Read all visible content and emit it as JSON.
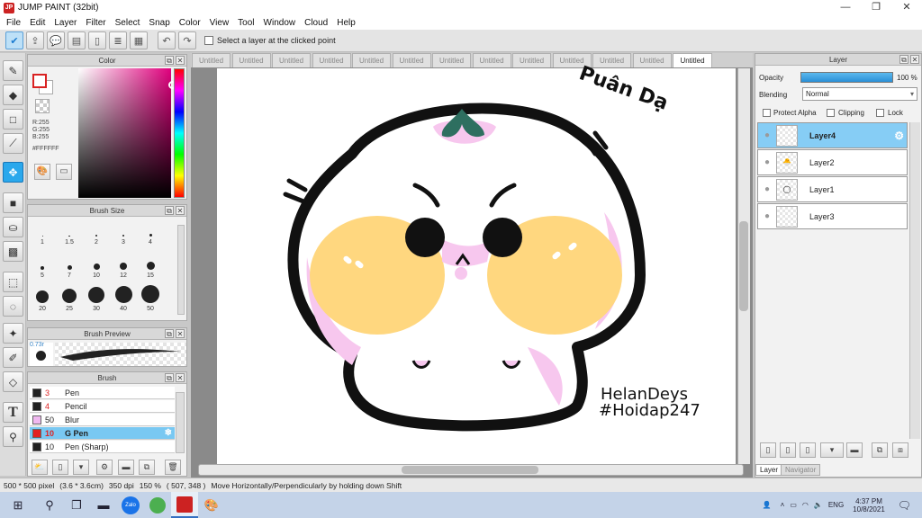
{
  "window": {
    "title": "JUMP PAINT (32bit)",
    "app_icon_text": "JP",
    "controls": [
      "—",
      "❐",
      "✕"
    ]
  },
  "menu": [
    "File",
    "Edit",
    "Layer",
    "Filter",
    "Select",
    "Snap",
    "Color",
    "View",
    "Tool",
    "Window",
    "Cloud",
    "Help"
  ],
  "toolbar": {
    "checkbox_label": "Select a layer at the clicked point"
  },
  "color_panel": {
    "title": "Color",
    "r": "R:255",
    "g": "G:255",
    "b": "B:255",
    "hex": "#FFFFFF",
    "fg_color": "#FFFFFF",
    "accent": "#d92222"
  },
  "brush_size": {
    "title": "Brush Size",
    "sizes": [
      "1",
      "1.5",
      "2",
      "3",
      "4",
      "5",
      "7",
      "10",
      "12",
      "15",
      "20",
      "25",
      "30",
      "40",
      "50"
    ]
  },
  "brush_preview": {
    "title": "Brush Preview",
    "size_label": "0.73r"
  },
  "brush_list": {
    "title": "Brush",
    "items": [
      {
        "size": "3",
        "name": "Pen",
        "color": "#222222",
        "size_color": "#d22"
      },
      {
        "size": "4",
        "name": "Pencil",
        "color": "#222222",
        "size_color": "#d22"
      },
      {
        "size": "50",
        "name": "Blur",
        "color": "#f0b8f0",
        "size_color": "#222"
      },
      {
        "size": "10",
        "name": "G Pen",
        "color": "#e22222",
        "size_color": "#d22"
      },
      {
        "size": "10",
        "name": "Pen (Sharp)",
        "color": "#222222",
        "size_color": "#222"
      }
    ],
    "selected_index": 3
  },
  "tabs": [
    "Untitled",
    "Untitled",
    "Untitled",
    "Untitled",
    "Untitled",
    "Untitled",
    "Untitled",
    "Untitled",
    "Untitled",
    "Untitled",
    "Untitled",
    "Untitled",
    "Untitled"
  ],
  "active_tab": 12,
  "canvas": {
    "text_right": "Puân Dạ",
    "credit_1": "HelanDeys",
    "credit_2": "#Hoidap247"
  },
  "layer_panel": {
    "title": "Layer",
    "opacity_label": "Opacity",
    "opacity_value": "100 %",
    "blending_label": "Blending",
    "blending_value": "Normal",
    "protect_alpha": "Protect Alpha",
    "clipping": "Clipping",
    "lock": "Lock",
    "layers": [
      "Layer4",
      "Layer2",
      "Layer1",
      "Layer3"
    ],
    "selected": 0,
    "tab_layer": "Layer",
    "tab_navigator": "Navigator"
  },
  "status": {
    "dims": "500 * 500 pixel",
    "cm": "(3.6 * 3.6cm)",
    "dpi": "350 dpi",
    "zoom": "150 %",
    "coords": "( 507, 348 )",
    "hint": "Move Horizontally/Perpendicularly by holding down Shift"
  },
  "taskbar": {
    "time": "4:37 PM",
    "date": "10/8/2021",
    "lang": "ENG",
    "zalo": "Zalo"
  }
}
